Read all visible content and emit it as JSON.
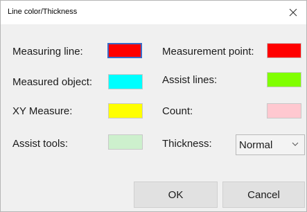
{
  "window": {
    "title": "Line color/Thickness"
  },
  "left_column": [
    {
      "label": "Measuring line:",
      "color": "#ff0000"
    },
    {
      "label": "Measured object:",
      "color": "#00ffff"
    },
    {
      "label": "XY Measure:",
      "color": "#ffff00"
    },
    {
      "label": "Assist tools:",
      "color": "#cdf0cd"
    }
  ],
  "right_column": [
    {
      "label": "Measurement point:",
      "color": "#ff0000"
    },
    {
      "label": "Assist lines:",
      "color": "#80ff00"
    },
    {
      "label": "Count:",
      "color": "#ffc8d0"
    }
  ],
  "thickness": {
    "label": "Thickness:",
    "value": "Normal"
  },
  "buttons": {
    "ok": "OK",
    "cancel": "Cancel"
  },
  "icons": {
    "close": "close-icon",
    "dropdown": "chevron-down-icon"
  }
}
